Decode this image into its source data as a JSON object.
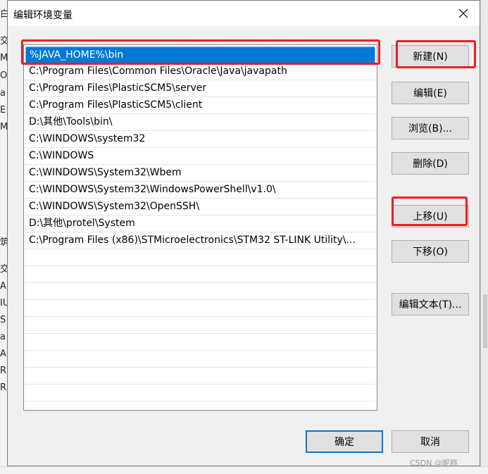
{
  "dialog": {
    "title": "编辑环境变量",
    "paths": [
      "%JAVA_HOME%\\bin",
      "C:\\Program Files\\Common Files\\Oracle\\Java\\javapath",
      "C:\\Program Files\\PlasticSCM5\\server",
      "C:\\Program Files\\PlasticSCM5\\client",
      "D:\\其他\\Tools\\bin\\",
      "C:\\WINDOWS\\system32",
      "C:\\WINDOWS",
      "C:\\WINDOWS\\System32\\Wbem",
      "C:\\WINDOWS\\System32\\WindowsPowerShell\\v1.0\\",
      "C:\\WINDOWS\\System32\\OpenSSH\\",
      "D:\\其他\\protel\\System",
      "C:\\Program Files (x86)\\STMicroelectronics\\STM32 ST-LINK Utility\\..."
    ],
    "buttons": {
      "new": "新建(N)",
      "edit": "编辑(E)",
      "browse": "浏览(B)...",
      "delete": "删除(D)",
      "move_up": "上移(U)",
      "move_down": "下移(O)",
      "edit_text": "编辑文本(T)...",
      "ok": "确定",
      "cancel": "取消"
    }
  },
  "background": {
    "left_fragments": [
      "白",
      "交",
      "M",
      "Or",
      "a",
      "E",
      "M",
      "筑",
      "交",
      "A",
      "IU",
      "S",
      "a",
      "A",
      "R",
      "R"
    ]
  },
  "watermark": "CSDN @昵称",
  "colors": {
    "selection": "#0078d7",
    "highlight": "#ee1d24",
    "default_button_border": "#0078d7"
  }
}
